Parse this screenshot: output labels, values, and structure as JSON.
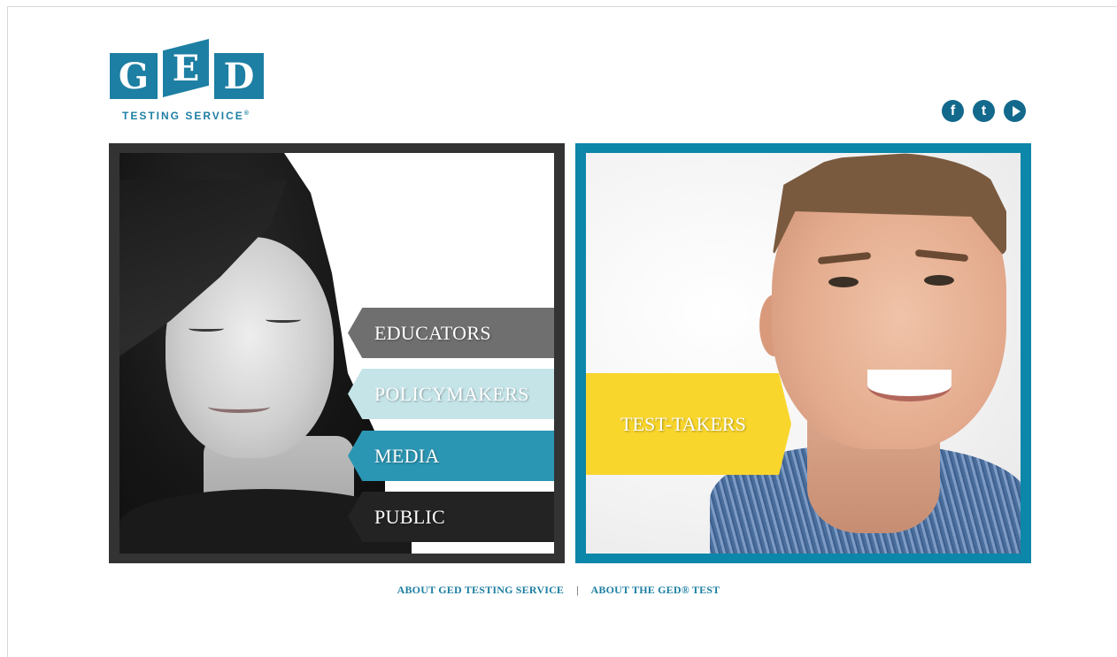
{
  "logo": {
    "letters": [
      "G",
      "E",
      "D"
    ],
    "tagline": "TESTING SERVICE",
    "tagline_mark": "®",
    "brand_color": "#1d7fa3"
  },
  "social": {
    "facebook": "f",
    "twitter": "t",
    "video": "video-play-icon"
  },
  "audience_nav": {
    "educators": "EDUCATORS",
    "policymakers": "POLICYMAKERS",
    "media": "MEDIA",
    "public": "PUBLIC",
    "panel_color": "#333333"
  },
  "test_takers": {
    "label": "TEST-TAKERS",
    "panel_color": "#0c86a9",
    "tab_color": "#f9d62c"
  },
  "footer": {
    "about_service": "ABOUT GED TESTING SERVICE",
    "separator": "|",
    "about_test": "ABOUT THE GED® TEST"
  }
}
